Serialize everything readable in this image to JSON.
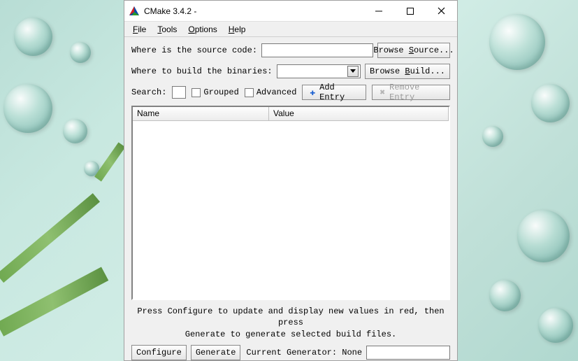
{
  "window": {
    "title": "CMake 3.4.2 -"
  },
  "menubar": {
    "file": "File",
    "tools": "Tools",
    "options": "Options",
    "help": "Help"
  },
  "form": {
    "source_label": "Where is the source code:",
    "source_value": "",
    "browse_source": "Browse Source...",
    "build_label": "Where to build the binaries:",
    "build_value": "",
    "browse_build": "Browse Build..."
  },
  "toolbar": {
    "search_label": "Search:",
    "search_value": "",
    "grouped_label": "Grouped",
    "grouped_checked": false,
    "advanced_label": "Advanced",
    "advanced_checked": false,
    "add_entry": "Add Entry",
    "remove_entry": "Remove Entry"
  },
  "table": {
    "columns": {
      "name": "Name",
      "value": "Value"
    },
    "rows": []
  },
  "hint": {
    "line1": "Press Configure to update and display new values in red, then press",
    "line2": "Generate to generate selected build files."
  },
  "bottom": {
    "configure": "Configure",
    "generate": "Generate",
    "current_generator_label": "Current Generator:",
    "current_generator_value": "None"
  }
}
